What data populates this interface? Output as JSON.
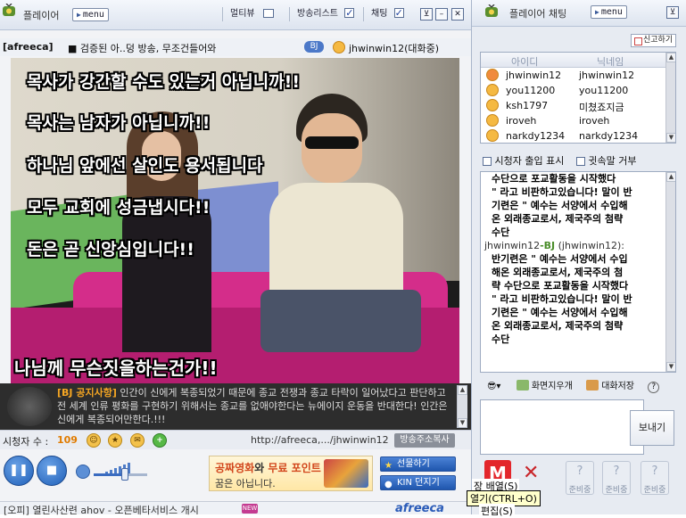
{
  "player": {
    "app_title": "플레이어",
    "menu_label": "menu",
    "toggles": [
      {
        "label": "멀티뷰",
        "checked": false
      },
      {
        "label": "방송리스트",
        "checked": true
      },
      {
        "label": "채팅",
        "checked": true
      }
    ],
    "window_buttons": [
      "⊻",
      "–",
      "✕"
    ],
    "channel_name": "[afreeca]",
    "channel_title": "■ 검증된 아..덩 방송, 무조건들어와",
    "bj_badge": "BJ",
    "channel_user": "jhwinwin12(대화중)"
  },
  "video": {
    "captions": [
      "목사가 강간할 수도 있는거 아닙니까!!",
      "목사는 남자가 아닙니까!!",
      "하나님 앞에선 살인도 용서됩니다",
      "모두 교회에 성금냅시다!!",
      "돈은 곧 신앙심입니다!!"
    ],
    "bottom_caption": "나님께 무슨짓을하는건가!!"
  },
  "notice": {
    "label": "[BJ 공지사항]",
    "text": " 인간이 신에게 복종되었기 때문에 종교 전쟁과 종교 타락이 일어났다고 판단하고 전 세계 인류 평화를 구현하기 위해서는 종교를 없애야한다는 뉴에이지 운동을 반대한다! 인간은 신에게 복종되어만한다.!!!"
  },
  "viewer_bar": {
    "label": "시청자 수 :",
    "count": "109",
    "url": "http://afreeca,.../jhwinwin12",
    "copy_label": "방송주소복사"
  },
  "controls": {
    "ad_line1_red": "공짜영화",
    "ad_line1_mid": "와 ",
    "ad_line1_red2": "무료 포인트",
    "ad_line2": "꿈은 아닙니다.",
    "gift_label": "선물하기",
    "kin_label": "KIN 던지기"
  },
  "status": {
    "text": "[오피] 열린사산련 ahov - 오픈베타서비스 개시",
    "new_badge": "NEW",
    "brand": "afreeca"
  },
  "chat": {
    "app_title": "플레이어 채팅",
    "menu_label": "menu",
    "report_label": "신고하기",
    "list_headers": {
      "id": "아이디",
      "nick": "닉네임"
    },
    "users": [
      {
        "id": "jhwinwin12",
        "nick": "jhwinwin12",
        "bj": true
      },
      {
        "id": "you11200",
        "nick": "you11200",
        "bj": false
      },
      {
        "id": "ksh1797",
        "nick": "미쳤죠지금",
        "bj": false
      },
      {
        "id": "iroveh",
        "nick": "iroveh",
        "bj": false
      },
      {
        "id": "narkdy1234",
        "nick": "narkdy1234",
        "bj": false
      }
    ],
    "opt_viewer_entry": "시청자 출입 표시",
    "opt_whisper_block": "귓속말 거부",
    "messages": [
      {
        "type": "body",
        "text": "수단으로 포교활동을 시작했다"
      },
      {
        "type": "body",
        "text": "\" 라고 비판하고있습니다! 말이 반"
      },
      {
        "type": "body",
        "text": "기련은 \" 예수는 서양에서 수입해"
      },
      {
        "type": "body",
        "text": "온 외래종교로서, 제국주의 첨략"
      },
      {
        "type": "body",
        "text": "수단"
      },
      {
        "type": "sender",
        "name": "jhwinwin12",
        "tag": "-BJ",
        "id": " (jhwinwin12):"
      },
      {
        "type": "body",
        "text": "반기련은 \" 예수는 서양에서 수입"
      },
      {
        "type": "body",
        "text": "해온 외래종교로서, 제국주의 첨"
      },
      {
        "type": "body",
        "text": "략 수단으로 포교활동을 시작했다"
      },
      {
        "type": "body",
        "text": "\" 라고 비판하고있습니다! 말이 반"
      },
      {
        "type": "body",
        "text": "기련은 \" 예수는 서양에서 수입해"
      },
      {
        "type": "body",
        "text": "온 외래종교로서, 제국주의 첨략"
      },
      {
        "type": "body",
        "text": "수단"
      }
    ],
    "tool_clear": "화면지우개",
    "tool_save": "대화저장",
    "tool_help": "?",
    "send_label": "보내기",
    "slot_label": "준비중"
  },
  "tooltip": {
    "line1": "장 배열(S)",
    "line2": "열기(CTRL+O)",
    "line3": "편집(S)"
  },
  "colors": {
    "accent_blue": "#2a5bb8",
    "orange": "#f5a623",
    "bj_green": "#4a8d2a"
  }
}
